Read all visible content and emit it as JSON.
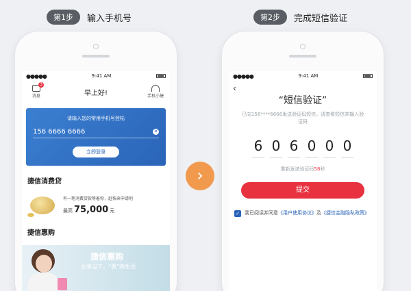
{
  "step1": {
    "pill": "第1步",
    "title": "输入手机号"
  },
  "step2": {
    "pill": "第2步",
    "title": "完成短信验证"
  },
  "status": {
    "time": "9:41 AM",
    "dots": "●●●●●"
  },
  "left": {
    "msg_label": "消息",
    "badge": "3",
    "greeting": "早上好!",
    "service_label": "手机小捷",
    "login_hint": "请输入您的常用手机号登陆",
    "phone_value": "156 6666 6666",
    "login_button": "立即登录",
    "loan_title": "捷信消费贷",
    "loan_desc": "有一笔消费贷款等着你，赶快来申请吧",
    "loan_prefix": "最高",
    "loan_amount": "75,000",
    "loan_unit": "元",
    "promo_section": "捷信惠购",
    "promo_banner_title": "捷信惠购",
    "promo_banner_sub": "立享当下，“惠”购生活"
  },
  "right": {
    "back": "‹",
    "title": "“短信验证”",
    "desc": "已向156****6666发送验证码短信，请查看短信并输入验证码",
    "code": [
      "6",
      "0",
      "6",
      "0",
      "0",
      "0"
    ],
    "resend_prefix": "重新发送验证码",
    "resend_seconds": "58",
    "resend_suffix": "秒",
    "submit": "提交",
    "agree_prefix": "我已阅读并同意",
    "agree_link1": "《用户使用协议》",
    "agree_and": "及",
    "agree_link2": "《捷信金融隐私政策》"
  },
  "arrow": "›"
}
